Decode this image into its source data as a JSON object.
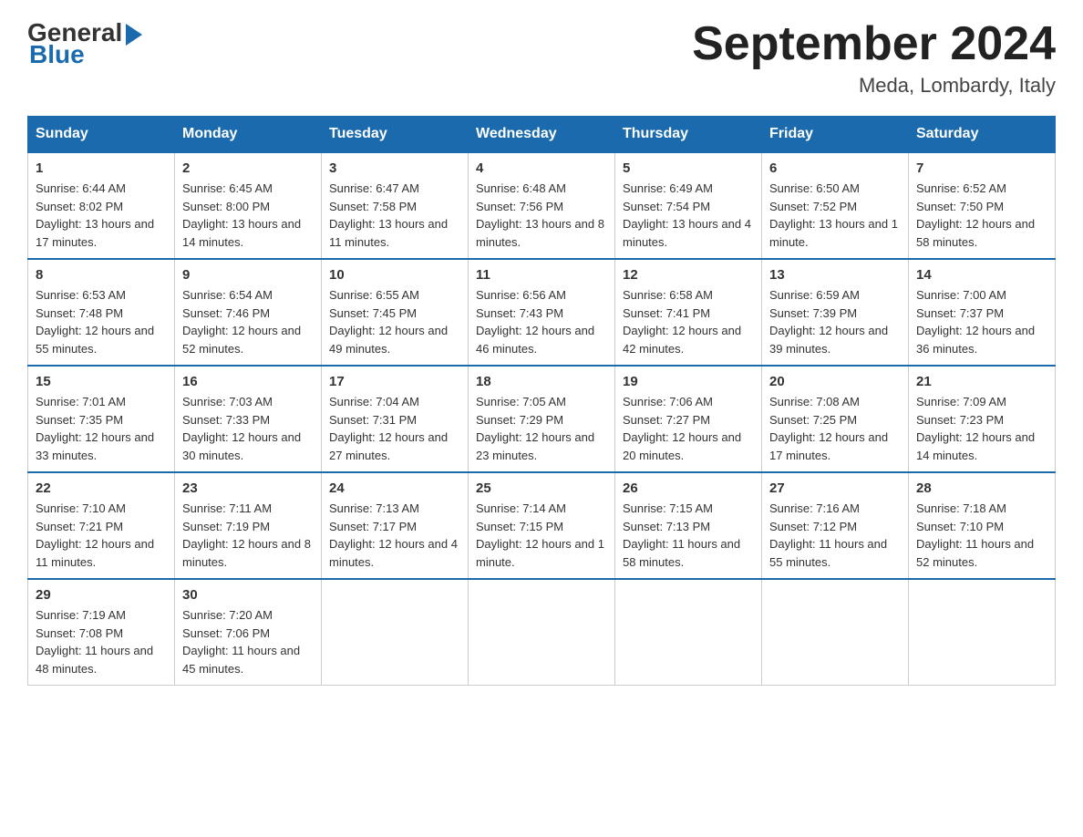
{
  "header": {
    "logo_general": "General",
    "logo_blue": "Blue",
    "month_title": "September 2024",
    "location": "Meda, Lombardy, Italy"
  },
  "days_of_week": [
    "Sunday",
    "Monday",
    "Tuesday",
    "Wednesday",
    "Thursday",
    "Friday",
    "Saturday"
  ],
  "weeks": [
    [
      {
        "day": "1",
        "sunrise": "6:44 AM",
        "sunset": "8:02 PM",
        "daylight": "13 hours and 17 minutes."
      },
      {
        "day": "2",
        "sunrise": "6:45 AM",
        "sunset": "8:00 PM",
        "daylight": "13 hours and 14 minutes."
      },
      {
        "day": "3",
        "sunrise": "6:47 AM",
        "sunset": "7:58 PM",
        "daylight": "13 hours and 11 minutes."
      },
      {
        "day": "4",
        "sunrise": "6:48 AM",
        "sunset": "7:56 PM",
        "daylight": "13 hours and 8 minutes."
      },
      {
        "day": "5",
        "sunrise": "6:49 AM",
        "sunset": "7:54 PM",
        "daylight": "13 hours and 4 minutes."
      },
      {
        "day": "6",
        "sunrise": "6:50 AM",
        "sunset": "7:52 PM",
        "daylight": "13 hours and 1 minute."
      },
      {
        "day": "7",
        "sunrise": "6:52 AM",
        "sunset": "7:50 PM",
        "daylight": "12 hours and 58 minutes."
      }
    ],
    [
      {
        "day": "8",
        "sunrise": "6:53 AM",
        "sunset": "7:48 PM",
        "daylight": "12 hours and 55 minutes."
      },
      {
        "day": "9",
        "sunrise": "6:54 AM",
        "sunset": "7:46 PM",
        "daylight": "12 hours and 52 minutes."
      },
      {
        "day": "10",
        "sunrise": "6:55 AM",
        "sunset": "7:45 PM",
        "daylight": "12 hours and 49 minutes."
      },
      {
        "day": "11",
        "sunrise": "6:56 AM",
        "sunset": "7:43 PM",
        "daylight": "12 hours and 46 minutes."
      },
      {
        "day": "12",
        "sunrise": "6:58 AM",
        "sunset": "7:41 PM",
        "daylight": "12 hours and 42 minutes."
      },
      {
        "day": "13",
        "sunrise": "6:59 AM",
        "sunset": "7:39 PM",
        "daylight": "12 hours and 39 minutes."
      },
      {
        "day": "14",
        "sunrise": "7:00 AM",
        "sunset": "7:37 PM",
        "daylight": "12 hours and 36 minutes."
      }
    ],
    [
      {
        "day": "15",
        "sunrise": "7:01 AM",
        "sunset": "7:35 PM",
        "daylight": "12 hours and 33 minutes."
      },
      {
        "day": "16",
        "sunrise": "7:03 AM",
        "sunset": "7:33 PM",
        "daylight": "12 hours and 30 minutes."
      },
      {
        "day": "17",
        "sunrise": "7:04 AM",
        "sunset": "7:31 PM",
        "daylight": "12 hours and 27 minutes."
      },
      {
        "day": "18",
        "sunrise": "7:05 AM",
        "sunset": "7:29 PM",
        "daylight": "12 hours and 23 minutes."
      },
      {
        "day": "19",
        "sunrise": "7:06 AM",
        "sunset": "7:27 PM",
        "daylight": "12 hours and 20 minutes."
      },
      {
        "day": "20",
        "sunrise": "7:08 AM",
        "sunset": "7:25 PM",
        "daylight": "12 hours and 17 minutes."
      },
      {
        "day": "21",
        "sunrise": "7:09 AM",
        "sunset": "7:23 PM",
        "daylight": "12 hours and 14 minutes."
      }
    ],
    [
      {
        "day": "22",
        "sunrise": "7:10 AM",
        "sunset": "7:21 PM",
        "daylight": "12 hours and 11 minutes."
      },
      {
        "day": "23",
        "sunrise": "7:11 AM",
        "sunset": "7:19 PM",
        "daylight": "12 hours and 8 minutes."
      },
      {
        "day": "24",
        "sunrise": "7:13 AM",
        "sunset": "7:17 PM",
        "daylight": "12 hours and 4 minutes."
      },
      {
        "day": "25",
        "sunrise": "7:14 AM",
        "sunset": "7:15 PM",
        "daylight": "12 hours and 1 minute."
      },
      {
        "day": "26",
        "sunrise": "7:15 AM",
        "sunset": "7:13 PM",
        "daylight": "11 hours and 58 minutes."
      },
      {
        "day": "27",
        "sunrise": "7:16 AM",
        "sunset": "7:12 PM",
        "daylight": "11 hours and 55 minutes."
      },
      {
        "day": "28",
        "sunrise": "7:18 AM",
        "sunset": "7:10 PM",
        "daylight": "11 hours and 52 minutes."
      }
    ],
    [
      {
        "day": "29",
        "sunrise": "7:19 AM",
        "sunset": "7:08 PM",
        "daylight": "11 hours and 48 minutes."
      },
      {
        "day": "30",
        "sunrise": "7:20 AM",
        "sunset": "7:06 PM",
        "daylight": "11 hours and 45 minutes."
      },
      null,
      null,
      null,
      null,
      null
    ]
  ]
}
